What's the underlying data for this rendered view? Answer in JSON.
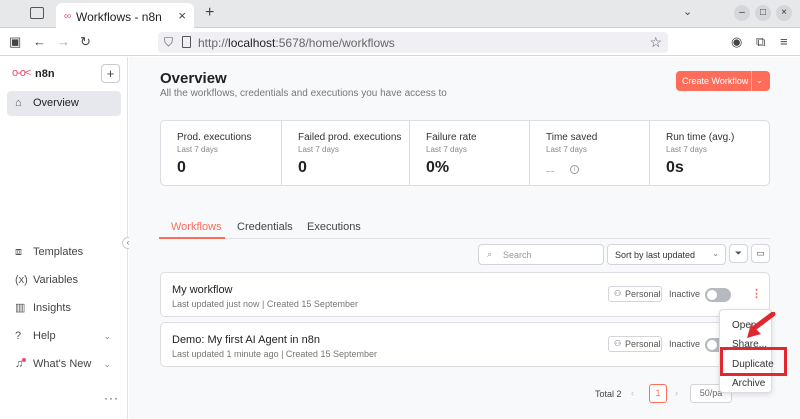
{
  "browser": {
    "tab_title": "Workflows - n8n",
    "url_prefix": "http://",
    "url_host": "localhost",
    "url_path": ":5678/home/workflows"
  },
  "sidebar": {
    "brand": "n8n",
    "items": [
      {
        "label": "Overview",
        "icon": "home-icon"
      },
      {
        "label": "Templates",
        "icon": "templates-icon"
      },
      {
        "label": "Variables",
        "icon": "variables-icon"
      },
      {
        "label": "Insights",
        "icon": "insights-icon"
      },
      {
        "label": "Help",
        "icon": "help-icon"
      },
      {
        "label": "What's New",
        "icon": "bell-icon"
      }
    ]
  },
  "header": {
    "title": "Overview",
    "subtitle": "All the workflows, credentials and executions you have access to",
    "create_label": "Create Workflow"
  },
  "stats": [
    {
      "label": "Prod. executions",
      "sub": "Last 7 days",
      "value": "0"
    },
    {
      "label": "Failed prod. executions",
      "sub": "Last 7 days",
      "value": "0"
    },
    {
      "label": "Failure rate",
      "sub": "Last 7 days",
      "value": "0%"
    },
    {
      "label": "Time saved",
      "sub": "Last 7 days",
      "value": "--"
    },
    {
      "label": "Run time (avg.)",
      "sub": "Last 7 days",
      "value": "0s"
    }
  ],
  "tabs": [
    "Workflows",
    "Credentials",
    "Executions"
  ],
  "toolbar": {
    "search_placeholder": "Search",
    "sort_value": "Sort by last updated"
  },
  "workflows": [
    {
      "name": "My workflow",
      "meta": "Last updated just now | Created 15 September",
      "owner": "Personal",
      "status": "Inactive"
    },
    {
      "name": "Demo: My first AI Agent in n8n",
      "meta": "Last updated 1 minute ago | Created 15 September",
      "owner": "Personal",
      "status": "Inactive"
    }
  ],
  "context_menu": [
    "Open",
    "Share...",
    "Duplicate",
    "Archive"
  ],
  "pagination": {
    "total": "Total 2",
    "current": "1",
    "page_size": "50/pa"
  },
  "colors": {
    "accent": "#ff6d5a",
    "highlight": "#e0282e"
  }
}
